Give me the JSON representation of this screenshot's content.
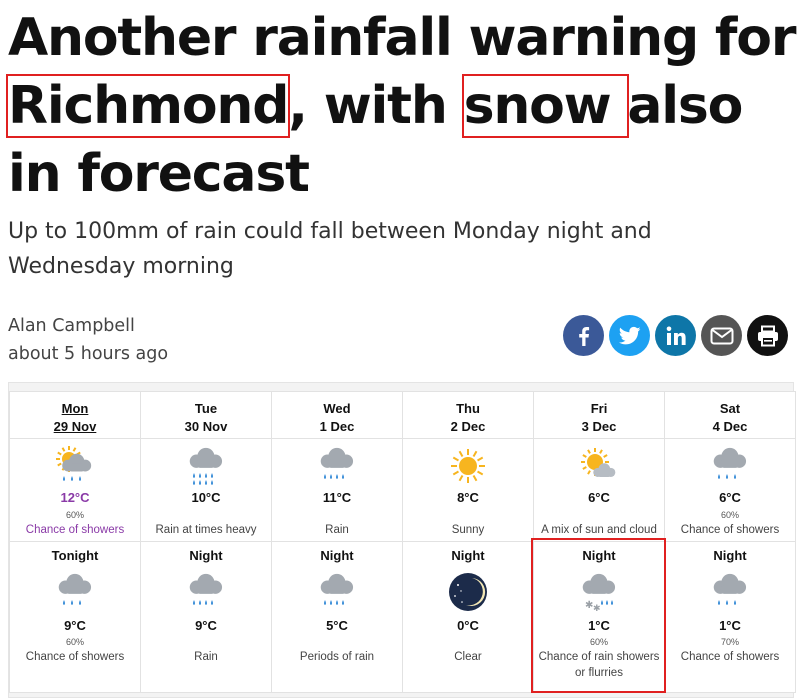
{
  "article": {
    "headline_parts": {
      "p1": "Another rainfall warning for ",
      "p2": "Richmond",
      "p3": ", with ",
      "p4": "snow ",
      "p5": "also in forecast"
    },
    "subheadline": "Up to 100mm of rain could fall between Monday night and Wednesday morning",
    "author": "Alan Campbell",
    "timestamp": "about 5 hours ago",
    "highlight_color": "#e02020"
  },
  "share": {
    "buttons": [
      {
        "name": "facebook",
        "icon": "facebook-icon",
        "color": "#3b5998"
      },
      {
        "name": "twitter",
        "icon": "twitter-icon",
        "color": "#1da1f2"
      },
      {
        "name": "linkedin",
        "icon": "linkedin-icon",
        "color": "#0e76a8"
      },
      {
        "name": "email",
        "icon": "email-icon",
        "color": "#555555"
      },
      {
        "name": "print",
        "icon": "print-icon",
        "color": "#111111"
      }
    ]
  },
  "weather": {
    "days": [
      {
        "day": "Mon",
        "date": "29 Nov",
        "icon": "sun-cloud-showers-icon",
        "temp": "12°C",
        "chance": "60%",
        "desc": "Chance of showers",
        "today": true
      },
      {
        "day": "Tue",
        "date": "30 Nov",
        "icon": "rain-heavy-icon",
        "temp": "10°C",
        "chance": "",
        "desc": "Rain at times heavy"
      },
      {
        "day": "Wed",
        "date": "1 Dec",
        "icon": "rain-icon",
        "temp": "11°C",
        "chance": "",
        "desc": "Rain"
      },
      {
        "day": "Thu",
        "date": "2 Dec",
        "icon": "sun-icon",
        "temp": "8°C",
        "chance": "",
        "desc": "Sunny"
      },
      {
        "day": "Fri",
        "date": "3 Dec",
        "icon": "sun-cloud-icon",
        "temp": "6°C",
        "chance": "",
        "desc": "A mix of sun and cloud"
      },
      {
        "day": "Sat",
        "date": "4 Dec",
        "icon": "showers-icon",
        "temp": "6°C",
        "chance": "60%",
        "desc": "Chance of showers"
      }
    ],
    "nights": [
      {
        "label": "Tonight",
        "icon": "showers-icon",
        "temp": "9°C",
        "chance": "60%",
        "desc": "Chance of showers"
      },
      {
        "label": "Night",
        "icon": "rain-icon",
        "temp": "9°C",
        "chance": "",
        "desc": "Rain"
      },
      {
        "label": "Night",
        "icon": "rain-icon",
        "temp": "5°C",
        "chance": "",
        "desc": "Periods of rain"
      },
      {
        "label": "Night",
        "icon": "moon-clear-icon",
        "temp": "0°C",
        "chance": "",
        "desc": "Clear"
      },
      {
        "label": "Night",
        "icon": "rain-snow-icon",
        "temp": "1°C",
        "chance": "60%",
        "desc": "Chance of rain showers or flurries",
        "highlighted": true
      },
      {
        "label": "Night",
        "icon": "showers-icon",
        "temp": "1°C",
        "chance": "70%",
        "desc": "Chance of showers"
      }
    ]
  }
}
